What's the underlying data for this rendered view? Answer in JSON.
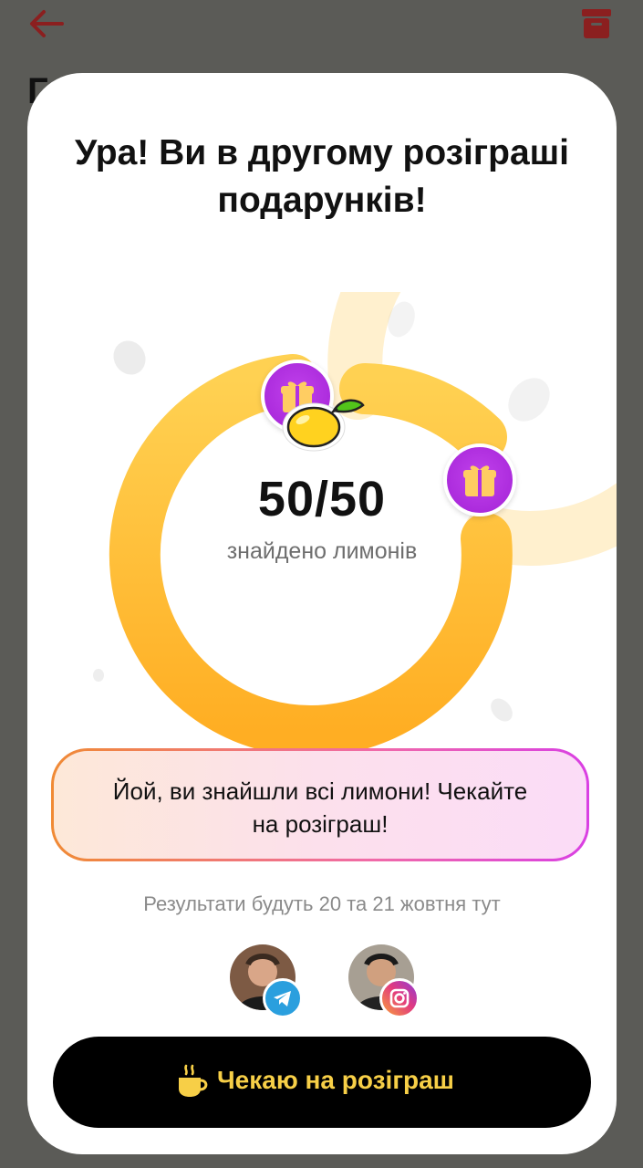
{
  "colors": {
    "accent_red": "#8b1f1f",
    "ring_yellow": "#ffb82e",
    "gift_purple": "#b232e4",
    "cta_text": "#f7cf47",
    "overlay": "#5b5b57"
  },
  "header": {
    "back_icon": "arrow-left-icon",
    "archive_icon": "archive-box-icon",
    "background_title_fragment": "Г"
  },
  "modal": {
    "title": "Ура! Ви в другому розіграші\nподарунків!",
    "progress": {
      "found": 50,
      "total": 50,
      "counter_text": "50/50",
      "label": "знайдено лимонів",
      "gift_icons": [
        "gift-icon",
        "gift-icon"
      ],
      "center_icon": "lemon-icon"
    },
    "notice": "Йой, ви знайшли всі лимони! Чекайте\nна розіграш!",
    "results_text": "Результати будуть 20 та 21 жовтня тут",
    "hosts": [
      {
        "avatar": "avatar-host-1",
        "network_icon": "telegram-icon"
      },
      {
        "avatar": "avatar-host-2",
        "network_icon": "instagram-icon"
      }
    ],
    "cta_label": "Чекаю на розіграш",
    "cta_icon": "coffee-cup-icon"
  }
}
